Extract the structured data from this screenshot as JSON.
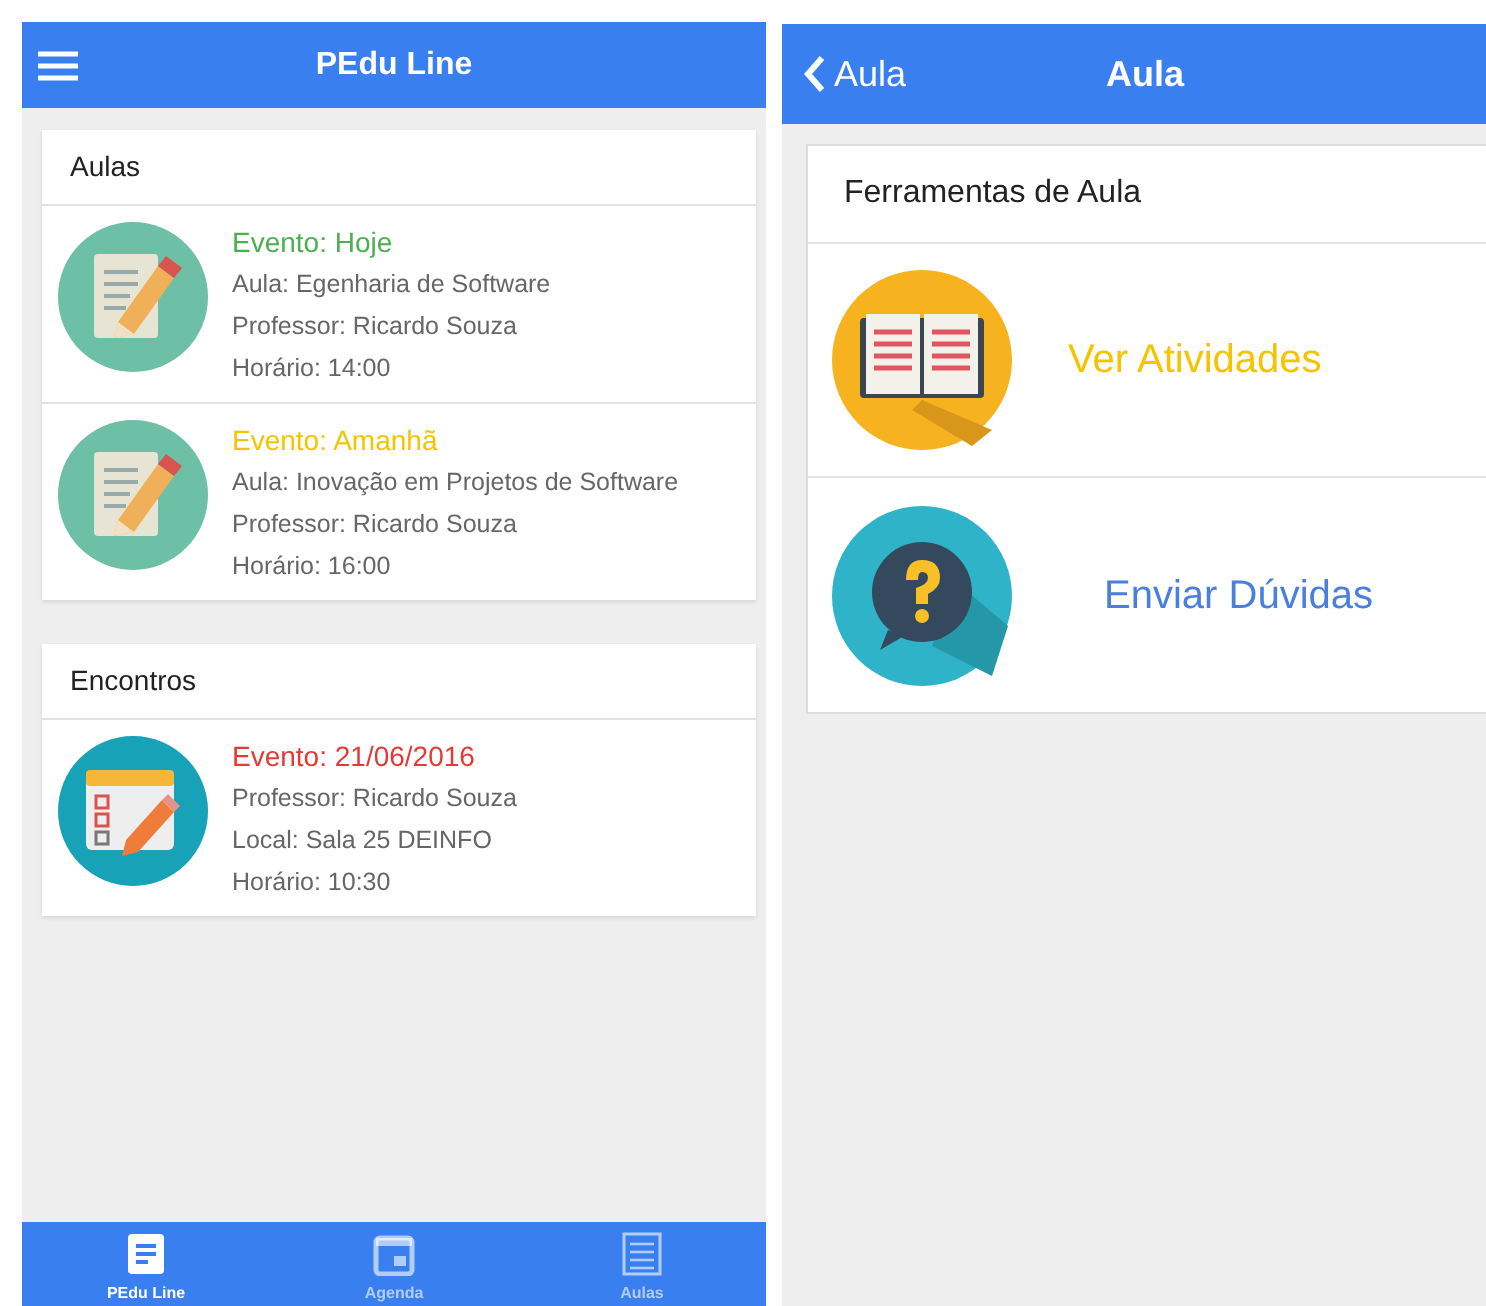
{
  "left_screen": {
    "app_bar": {
      "title": "PEdu Line"
    },
    "sections": [
      {
        "title": "Aulas",
        "items": [
          {
            "kind": "notes",
            "event": "Evento: Hoje",
            "color": "#4caf50",
            "lines": [
              "Aula: Egenharia de Software",
              "Professor: Ricardo Souza",
              "Horário: 14:00"
            ]
          },
          {
            "kind": "notes",
            "event": "Evento: Amanhã",
            "color": "#f5c400",
            "lines": [
              "Aula: Inovação em Projetos de Software",
              "Professor: Ricardo Souza",
              "Horário: 16:00"
            ]
          }
        ]
      },
      {
        "title": "Encontros",
        "items": [
          {
            "kind": "checklist",
            "event": "Evento: 21/06/2016",
            "color": "#e53935",
            "lines": [
              "Professor: Ricardo Souza",
              "Local: Sala 25 DEINFO",
              "Horário: 10:30"
            ]
          }
        ]
      }
    ],
    "bottom_tabs": [
      {
        "label": "PEdu Line",
        "kind": "doc",
        "selected": true
      },
      {
        "label": "Agenda",
        "kind": "calendar",
        "selected": false
      },
      {
        "label": "Aulas",
        "kind": "list",
        "selected": false
      }
    ]
  },
  "right_screen": {
    "app_bar": {
      "back": "Aula",
      "title": "Aula"
    },
    "card": {
      "title": "Ferramentas de Aula",
      "tools": [
        {
          "kind": "book",
          "label": "Ver Atividades",
          "color": "#f5c400"
        },
        {
          "kind": "question",
          "label": "Enviar Dúvidas",
          "color": "#4a7fe0"
        }
      ]
    }
  }
}
